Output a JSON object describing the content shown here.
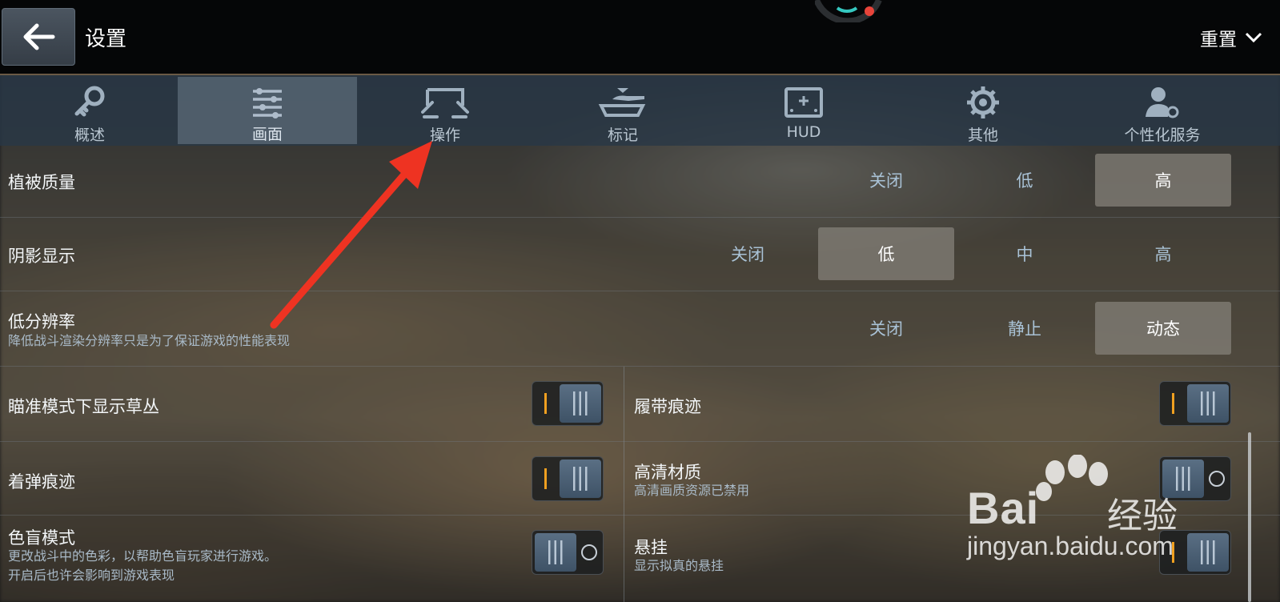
{
  "header": {
    "title": "设置",
    "reset_label": "重置"
  },
  "tabs": [
    {
      "label": "概述",
      "icon": "key-icon"
    },
    {
      "label": "画面",
      "icon": "sliders-icon",
      "active": true
    },
    {
      "label": "操作",
      "icon": "controls-icon"
    },
    {
      "label": "标记",
      "icon": "tank-icon"
    },
    {
      "label": "HUD",
      "icon": "hud-icon"
    },
    {
      "label": "其他",
      "icon": "gear-icon"
    },
    {
      "label": "个性化服务",
      "icon": "user-gear-icon"
    }
  ],
  "settings": {
    "vegetation": {
      "label": "植被质量",
      "options": [
        "关闭",
        "低",
        "高"
      ],
      "selected": "高"
    },
    "shadow": {
      "label": "阴影显示",
      "options": [
        "关闭",
        "低",
        "中",
        "高"
      ],
      "selected": "低"
    },
    "lowres": {
      "label": "低分辨率",
      "desc": "降低战斗渲染分辨率只是为了保证游戏的性能表现",
      "options": [
        "关闭",
        "静止",
        "动态"
      ],
      "selected": "动态"
    },
    "aim_grass": {
      "label": "瞄准模式下显示草丛",
      "on": true
    },
    "track_marks": {
      "label": "履带痕迹",
      "on": true
    },
    "impact_marks": {
      "label": "着弹痕迹",
      "on": true
    },
    "hd_textures": {
      "label": "高清材质",
      "desc": "高清画质资源已禁用",
      "on": false
    },
    "colorblind": {
      "label": "色盲模式",
      "desc1": "更改战斗中的色彩，以帮助色盲玩家进行游戏。",
      "desc2": "开启后也许会影响到游戏表现",
      "on": false
    },
    "suspension": {
      "label": "悬挂",
      "desc": "显示拟真的悬挂",
      "on": true
    }
  },
  "watermark": {
    "brand": "Bai",
    "brand_cn": "经验",
    "url": "jingyan.baidu.com"
  },
  "colors": {
    "accent_orange": "#f0a020",
    "arrow_red": "#ee3322",
    "toggle_knob": "#4a5f74"
  }
}
